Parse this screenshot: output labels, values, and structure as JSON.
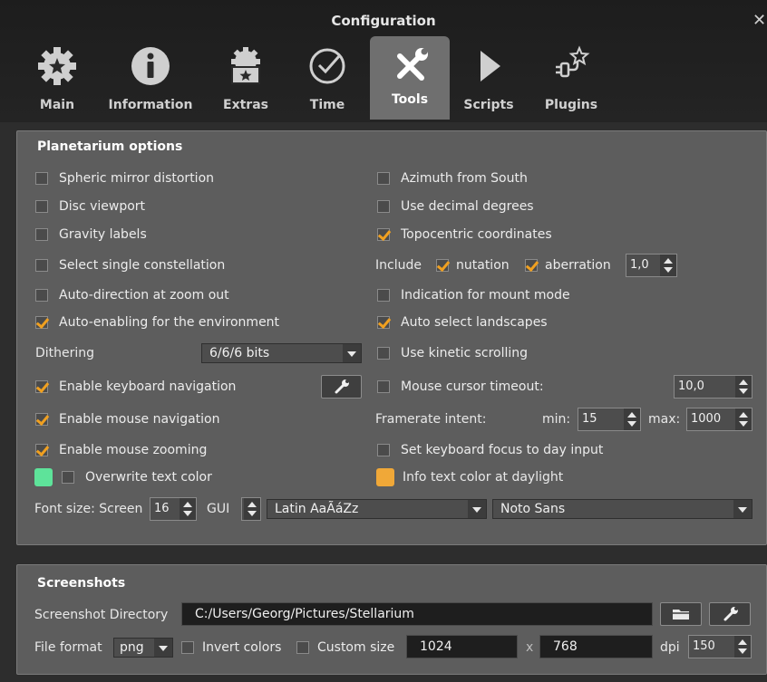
{
  "window": {
    "title": "Configuration",
    "close": "✕"
  },
  "tabs": [
    {
      "label": "Main",
      "icon": "gear-star-icon"
    },
    {
      "label": "Information",
      "icon": "info-icon"
    },
    {
      "label": "Extras",
      "icon": "gear-screen-icon"
    },
    {
      "label": "Time",
      "icon": "clock-icon"
    },
    {
      "label": "Tools",
      "icon": "tools-icon",
      "active": true
    },
    {
      "label": "Scripts",
      "icon": "play-icon"
    },
    {
      "label": "Plugins",
      "icon": "plug-star-icon"
    }
  ],
  "planetarium": {
    "title": "Planetarium options",
    "left": {
      "spheric_mirror": {
        "label": "Spheric mirror distortion",
        "checked": false
      },
      "disc_viewport": {
        "label": "Disc viewport",
        "checked": false
      },
      "gravity_labels": {
        "label": "Gravity labels",
        "checked": false
      },
      "single_constellation": {
        "label": "Select single constellation",
        "checked": false
      },
      "auto_direction": {
        "label": "Auto-direction at zoom out",
        "checked": false
      },
      "auto_environment": {
        "label": "Auto-enabling for the environment",
        "checked": true
      },
      "dithering_label": "Dithering",
      "dithering_value": "6/6/6 bits",
      "keyboard_nav": {
        "label": "Enable keyboard navigation",
        "checked": true
      },
      "mouse_nav": {
        "label": "Enable mouse navigation",
        "checked": true
      },
      "mouse_zoom": {
        "label": "Enable mouse zooming",
        "checked": true
      },
      "overwrite_color": {
        "label": "Overwrite text color",
        "checked": false
      }
    },
    "right": {
      "azimuth_south": {
        "label": "Azimuth from South",
        "checked": false
      },
      "decimal_degrees": {
        "label": "Use decimal degrees",
        "checked": false
      },
      "topocentric": {
        "label": "Topocentric coordinates",
        "checked": true
      },
      "include_label": "Include",
      "nutation": {
        "label": "nutation",
        "checked": true
      },
      "aberration": {
        "label": "aberration",
        "checked": true
      },
      "aberration_value": "1,0",
      "mount_mode": {
        "label": "Indication for mount mode",
        "checked": false
      },
      "auto_landscapes": {
        "label": "Auto select landscapes",
        "checked": true
      },
      "kinetic_scrolling": {
        "label": "Use kinetic scrolling",
        "checked": false
      },
      "cursor_timeout": {
        "label": "Mouse cursor timeout:",
        "checked": false
      },
      "cursor_timeout_value": "10,0",
      "framerate_label": "Framerate intent:",
      "min_label": "min:",
      "min_value": "15",
      "max_label": "max:",
      "max_value": "1000",
      "keyboard_focus": {
        "label": "Set keyboard focus to day input",
        "checked": false
      },
      "daylight_color": {
        "label": "Info text color at daylight"
      }
    },
    "font": {
      "label": "Font size: Screen",
      "screen_value": "16",
      "gui_label": "GUI",
      "script_sample": "Latin  AaÃáZz",
      "font_name": "Noto Sans"
    },
    "colors": {
      "overwrite_swatch": "#5ee39a",
      "daylight_swatch": "#f0a838"
    }
  },
  "screenshots": {
    "title": "Screenshots",
    "dir_label": "Screenshot Directory",
    "dir_value": "C:/Users/Georg/Pictures/Stellarium",
    "format_label": "File format",
    "format_value": "png",
    "invert": {
      "label": "Invert colors",
      "checked": false
    },
    "custom": {
      "label": "Custom size",
      "checked": false
    },
    "width": "1024",
    "x_label": "x",
    "height": "768",
    "dpi_label": "dpi",
    "dpi_value": "150"
  }
}
